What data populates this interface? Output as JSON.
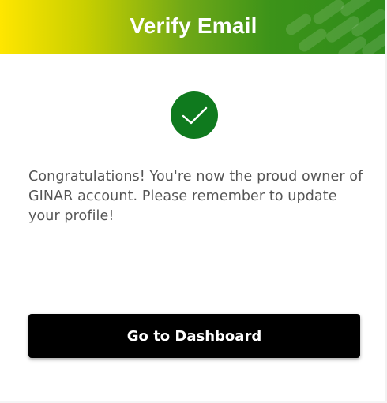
{
  "header": {
    "title": "Verify Email",
    "gradient_start": "#ffe600",
    "gradient_end": "#2e8b1a"
  },
  "status": {
    "icon": "check-circle-icon",
    "color": "#0f7a1e"
  },
  "message": {
    "text": "Congratulations! You're now the proud owner of GINAR account. Please remember to update your profile!",
    "color": "#555555"
  },
  "actions": {
    "dashboard_label": "Go to Dashboard",
    "button_color": "#000000"
  }
}
